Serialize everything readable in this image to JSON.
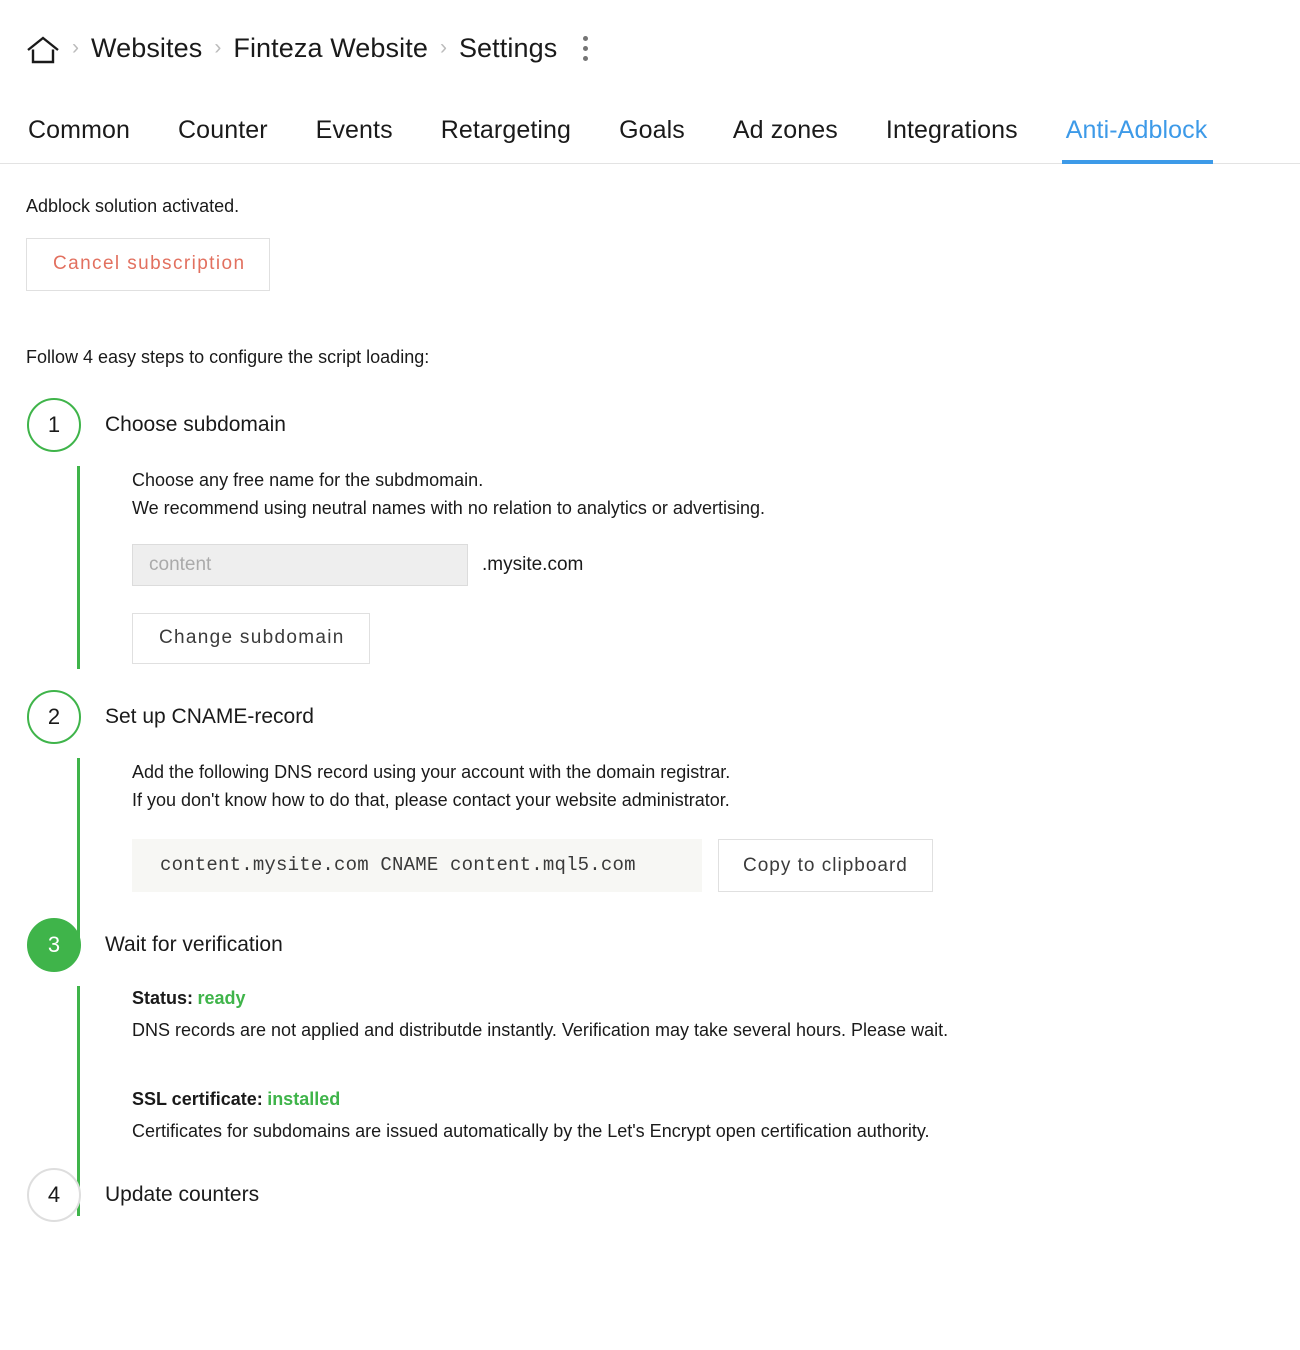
{
  "breadcrumb": {
    "home_icon": "home-icon",
    "separator": "›",
    "items": [
      {
        "label": "Websites"
      },
      {
        "label": "Finteza Website"
      },
      {
        "label": "Settings"
      }
    ],
    "overflow_menu": "kebab-menu-icon"
  },
  "tabs": [
    {
      "label": "Common",
      "active": false
    },
    {
      "label": "Counter",
      "active": false
    },
    {
      "label": "Events",
      "active": false
    },
    {
      "label": "Retargeting",
      "active": false
    },
    {
      "label": "Goals",
      "active": false
    },
    {
      "label": "Ad zones",
      "active": false
    },
    {
      "label": "Integrations",
      "active": false
    },
    {
      "label": "Anti-Adblock",
      "active": true
    }
  ],
  "main": {
    "status_line": "Adblock solution activated.",
    "cancel_button": "Cancel subscription",
    "follow_line": "Follow 4 easy steps to configure the script loading:",
    "steps": [
      {
        "number": "1",
        "title": "Choose subdomain",
        "state": "green-outline",
        "desc_line1": "Choose any free name for the subdmomain.",
        "desc_line2": "We recommend using neutral names with no relation to analytics or advertising.",
        "input_placeholder": "content",
        "input_value": "",
        "domain_suffix": ".mysite.com",
        "change_button": "Change subdomain"
      },
      {
        "number": "2",
        "title": "Set up CNAME-record",
        "state": "green-outline",
        "desc_line1": "Add the following DNS record using your account with the domain registrar.",
        "desc_line2": "If you don't know how to do that, please contact your website administrator.",
        "cname_record": "content.mysite.com CNAME content.mql5.com",
        "copy_button": "Copy to clipboard"
      },
      {
        "number": "3",
        "title": "Wait for verification",
        "state": "green-filled",
        "status_label": "Status:",
        "status_value": "ready",
        "status_desc": "DNS records are not applied and distributde instantly. Verification may take several hours. Please wait.",
        "ssl_label": "SSL certificate:",
        "ssl_value": "installed",
        "ssl_desc": "Certificates for subdomains are issued automatically by the Let's Encrypt open certification authority."
      },
      {
        "number": "4",
        "title": "Update counters",
        "state": "gray-outline"
      }
    ]
  },
  "colors": {
    "accent_blue": "#3d9ae8",
    "green": "#3fb44a",
    "danger_red": "#e2705f",
    "text": "#1a1a1a",
    "muted": "#bcbcbc"
  }
}
